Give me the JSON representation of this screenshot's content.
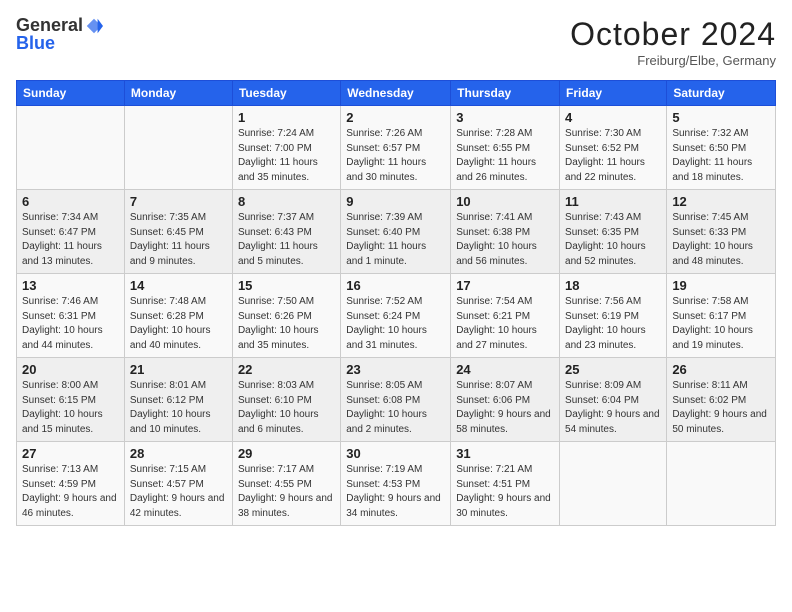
{
  "header": {
    "logo_general": "General",
    "logo_blue": "Blue",
    "month_title": "October 2024",
    "location": "Freiburg/Elbe, Germany"
  },
  "weekdays": [
    "Sunday",
    "Monday",
    "Tuesday",
    "Wednesday",
    "Thursday",
    "Friday",
    "Saturday"
  ],
  "weeks": [
    [
      {
        "day": "",
        "sunrise": "",
        "sunset": "",
        "daylight": ""
      },
      {
        "day": "",
        "sunrise": "",
        "sunset": "",
        "daylight": ""
      },
      {
        "day": "1",
        "sunrise": "Sunrise: 7:24 AM",
        "sunset": "Sunset: 7:00 PM",
        "daylight": "Daylight: 11 hours and 35 minutes."
      },
      {
        "day": "2",
        "sunrise": "Sunrise: 7:26 AM",
        "sunset": "Sunset: 6:57 PM",
        "daylight": "Daylight: 11 hours and 30 minutes."
      },
      {
        "day": "3",
        "sunrise": "Sunrise: 7:28 AM",
        "sunset": "Sunset: 6:55 PM",
        "daylight": "Daylight: 11 hours and 26 minutes."
      },
      {
        "day": "4",
        "sunrise": "Sunrise: 7:30 AM",
        "sunset": "Sunset: 6:52 PM",
        "daylight": "Daylight: 11 hours and 22 minutes."
      },
      {
        "day": "5",
        "sunrise": "Sunrise: 7:32 AM",
        "sunset": "Sunset: 6:50 PM",
        "daylight": "Daylight: 11 hours and 18 minutes."
      }
    ],
    [
      {
        "day": "6",
        "sunrise": "Sunrise: 7:34 AM",
        "sunset": "Sunset: 6:47 PM",
        "daylight": "Daylight: 11 hours and 13 minutes."
      },
      {
        "day": "7",
        "sunrise": "Sunrise: 7:35 AM",
        "sunset": "Sunset: 6:45 PM",
        "daylight": "Daylight: 11 hours and 9 minutes."
      },
      {
        "day": "8",
        "sunrise": "Sunrise: 7:37 AM",
        "sunset": "Sunset: 6:43 PM",
        "daylight": "Daylight: 11 hours and 5 minutes."
      },
      {
        "day": "9",
        "sunrise": "Sunrise: 7:39 AM",
        "sunset": "Sunset: 6:40 PM",
        "daylight": "Daylight: 11 hours and 1 minute."
      },
      {
        "day": "10",
        "sunrise": "Sunrise: 7:41 AM",
        "sunset": "Sunset: 6:38 PM",
        "daylight": "Daylight: 10 hours and 56 minutes."
      },
      {
        "day": "11",
        "sunrise": "Sunrise: 7:43 AM",
        "sunset": "Sunset: 6:35 PM",
        "daylight": "Daylight: 10 hours and 52 minutes."
      },
      {
        "day": "12",
        "sunrise": "Sunrise: 7:45 AM",
        "sunset": "Sunset: 6:33 PM",
        "daylight": "Daylight: 10 hours and 48 minutes."
      }
    ],
    [
      {
        "day": "13",
        "sunrise": "Sunrise: 7:46 AM",
        "sunset": "Sunset: 6:31 PM",
        "daylight": "Daylight: 10 hours and 44 minutes."
      },
      {
        "day": "14",
        "sunrise": "Sunrise: 7:48 AM",
        "sunset": "Sunset: 6:28 PM",
        "daylight": "Daylight: 10 hours and 40 minutes."
      },
      {
        "day": "15",
        "sunrise": "Sunrise: 7:50 AM",
        "sunset": "Sunset: 6:26 PM",
        "daylight": "Daylight: 10 hours and 35 minutes."
      },
      {
        "day": "16",
        "sunrise": "Sunrise: 7:52 AM",
        "sunset": "Sunset: 6:24 PM",
        "daylight": "Daylight: 10 hours and 31 minutes."
      },
      {
        "day": "17",
        "sunrise": "Sunrise: 7:54 AM",
        "sunset": "Sunset: 6:21 PM",
        "daylight": "Daylight: 10 hours and 27 minutes."
      },
      {
        "day": "18",
        "sunrise": "Sunrise: 7:56 AM",
        "sunset": "Sunset: 6:19 PM",
        "daylight": "Daylight: 10 hours and 23 minutes."
      },
      {
        "day": "19",
        "sunrise": "Sunrise: 7:58 AM",
        "sunset": "Sunset: 6:17 PM",
        "daylight": "Daylight: 10 hours and 19 minutes."
      }
    ],
    [
      {
        "day": "20",
        "sunrise": "Sunrise: 8:00 AM",
        "sunset": "Sunset: 6:15 PM",
        "daylight": "Daylight: 10 hours and 15 minutes."
      },
      {
        "day": "21",
        "sunrise": "Sunrise: 8:01 AM",
        "sunset": "Sunset: 6:12 PM",
        "daylight": "Daylight: 10 hours and 10 minutes."
      },
      {
        "day": "22",
        "sunrise": "Sunrise: 8:03 AM",
        "sunset": "Sunset: 6:10 PM",
        "daylight": "Daylight: 10 hours and 6 minutes."
      },
      {
        "day": "23",
        "sunrise": "Sunrise: 8:05 AM",
        "sunset": "Sunset: 6:08 PM",
        "daylight": "Daylight: 10 hours and 2 minutes."
      },
      {
        "day": "24",
        "sunrise": "Sunrise: 8:07 AM",
        "sunset": "Sunset: 6:06 PM",
        "daylight": "Daylight: 9 hours and 58 minutes."
      },
      {
        "day": "25",
        "sunrise": "Sunrise: 8:09 AM",
        "sunset": "Sunset: 6:04 PM",
        "daylight": "Daylight: 9 hours and 54 minutes."
      },
      {
        "day": "26",
        "sunrise": "Sunrise: 8:11 AM",
        "sunset": "Sunset: 6:02 PM",
        "daylight": "Daylight: 9 hours and 50 minutes."
      }
    ],
    [
      {
        "day": "27",
        "sunrise": "Sunrise: 7:13 AM",
        "sunset": "Sunset: 4:59 PM",
        "daylight": "Daylight: 9 hours and 46 minutes."
      },
      {
        "day": "28",
        "sunrise": "Sunrise: 7:15 AM",
        "sunset": "Sunset: 4:57 PM",
        "daylight": "Daylight: 9 hours and 42 minutes."
      },
      {
        "day": "29",
        "sunrise": "Sunrise: 7:17 AM",
        "sunset": "Sunset: 4:55 PM",
        "daylight": "Daylight: 9 hours and 38 minutes."
      },
      {
        "day": "30",
        "sunrise": "Sunrise: 7:19 AM",
        "sunset": "Sunset: 4:53 PM",
        "daylight": "Daylight: 9 hours and 34 minutes."
      },
      {
        "day": "31",
        "sunrise": "Sunrise: 7:21 AM",
        "sunset": "Sunset: 4:51 PM",
        "daylight": "Daylight: 9 hours and 30 minutes."
      },
      {
        "day": "",
        "sunrise": "",
        "sunset": "",
        "daylight": ""
      },
      {
        "day": "",
        "sunrise": "",
        "sunset": "",
        "daylight": ""
      }
    ]
  ]
}
